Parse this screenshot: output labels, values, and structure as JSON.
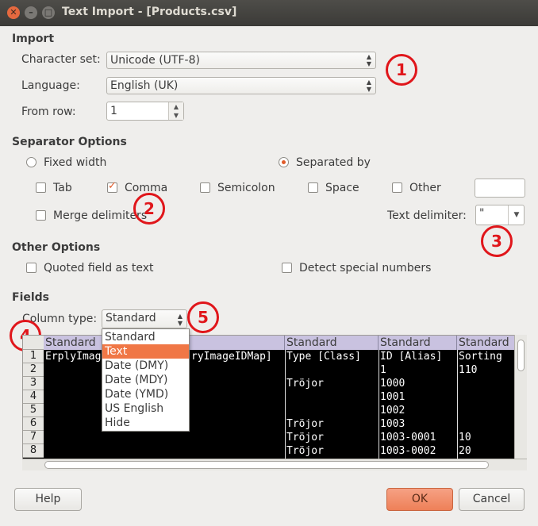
{
  "window": {
    "title": "Text Import - [Products.csv]",
    "close_glyph": "✕",
    "minimize_glyph": "–",
    "maximize_glyph": "□"
  },
  "import": {
    "heading": "Import",
    "charset_label": "Character set:",
    "charset_value": "Unicode (UTF-8)",
    "language_label": "Language:",
    "language_value": "English (UK)",
    "fromrow_label": "From row:",
    "fromrow_value": "1"
  },
  "separator": {
    "heading": "Separator Options",
    "fixed_width": "Fixed width",
    "separated_by": "Separated by",
    "tab": "Tab",
    "comma": "Comma",
    "semicolon": "Semicolon",
    "space": "Space",
    "other": "Other",
    "merge": "Merge delimiters",
    "text_delim_label": "Text delimiter:",
    "text_delim_value": "\""
  },
  "other_options": {
    "heading": "Other Options",
    "quoted": "Quoted field as text",
    "detect": "Detect special numbers"
  },
  "fields": {
    "heading": "Fields",
    "column_type_label": "Column type:",
    "column_type_value": "Standard",
    "options": [
      "Standard",
      "Text",
      "Date (DMY)",
      "Date (MDY)",
      "Date (YMD)",
      "US English",
      "Hide"
    ],
    "selected_option": "Text",
    "col_headers": [
      "Standard",
      "Standard",
      "Standard",
      "Standard",
      "Standard"
    ],
    "row_numbers": [
      "1",
      "2",
      "3",
      "4",
      "5",
      "6",
      "7",
      "8"
    ],
    "cells": {
      "r1c1": "ErplyImag",
      "r1c2": "ryImageIDMap]",
      "r1c3": "Type [Class]",
      "r1c4": "ID [Alias]",
      "r1c5": "Sorting",
      "r2c4": "1",
      "r2c5": "110",
      "r3c3": "Tröjor",
      "r3c4": "1000",
      "r4c4": "1001",
      "r5c4": "1002",
      "r6c3": "Tröjor",
      "r6c4": "1003",
      "r7c3": "Tröjor",
      "r7c4": "1003-0001",
      "r7c5": "10",
      "r8c3": "Tröjor",
      "r8c4": "1003-0002",
      "r8c5": "20"
    }
  },
  "buttons": {
    "help": "Help",
    "ok": "OK",
    "cancel": "Cancel"
  },
  "annotations": [
    "1",
    "2",
    "3",
    "4",
    "5"
  ],
  "colors": {
    "accent": "#e05b2a",
    "annotation": "#e0161b",
    "column_header": "#c9c2e0"
  }
}
